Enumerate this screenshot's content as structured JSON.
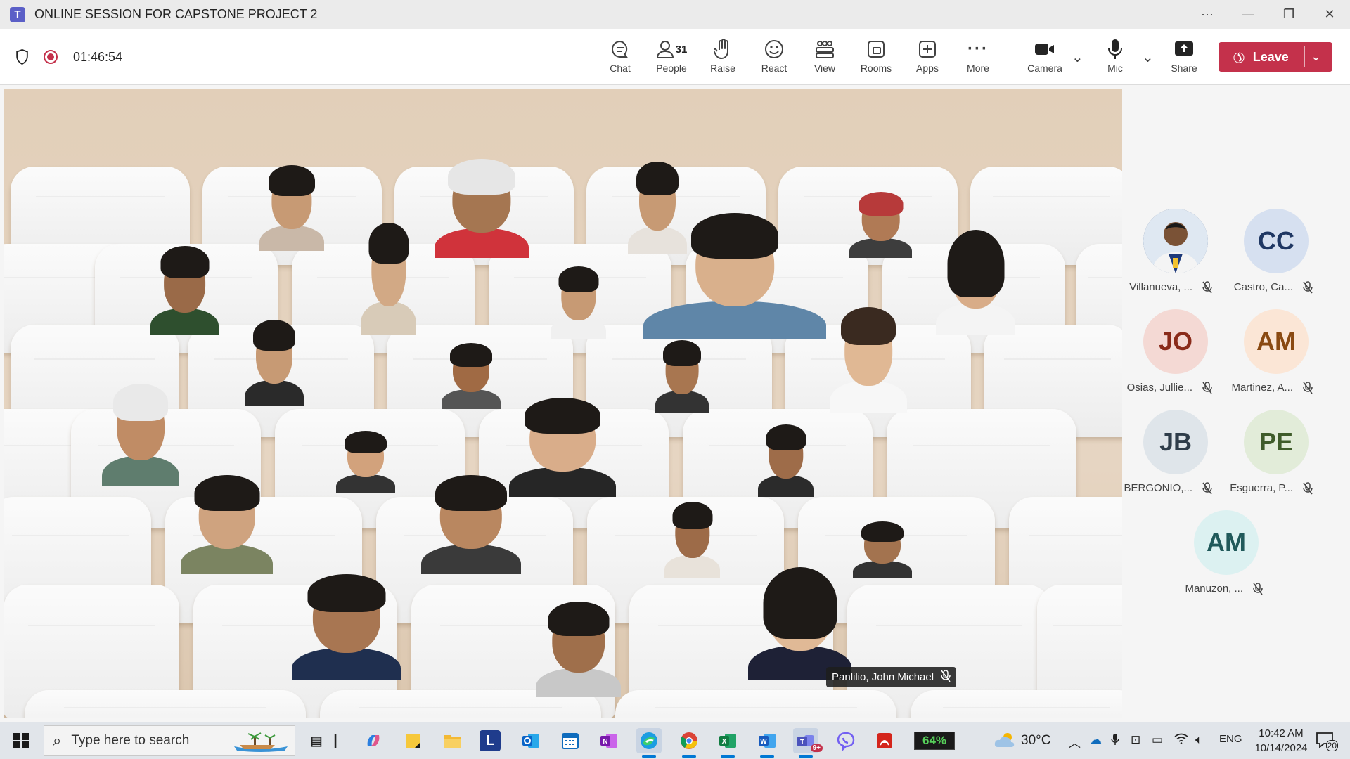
{
  "window": {
    "title": "ONLINE SESSION FOR CAPSTONE PROJECT 2",
    "controls": [
      "more-icon",
      "minimize-icon",
      "restore-icon",
      "close-icon"
    ]
  },
  "toolbar": {
    "timer": "01:46:54",
    "items": [
      {
        "label": "Chat",
        "icon": "chat-icon"
      },
      {
        "label": "People",
        "icon": "people-icon",
        "count": "31"
      },
      {
        "label": "Raise",
        "icon": "raise-hand-icon"
      },
      {
        "label": "React",
        "icon": "react-icon"
      },
      {
        "label": "View",
        "icon": "view-icon"
      },
      {
        "label": "Rooms",
        "icon": "rooms-icon"
      },
      {
        "label": "Apps",
        "icon": "apps-icon"
      },
      {
        "label": "More",
        "icon": "more-icon"
      },
      {
        "label": "Camera",
        "icon": "camera-icon"
      },
      {
        "label": "Mic",
        "icon": "mic-icon"
      },
      {
        "label": "Share",
        "icon": "share-icon"
      }
    ],
    "leave_label": "Leave",
    "leave_color": "#c4314b"
  },
  "stage": {
    "mode": "together-mode",
    "active_speaker_tag": "Panlilio, John Michael"
  },
  "participants_panel": [
    {
      "initials": "",
      "name": "Villanueva, ...",
      "avatar_type": "photo",
      "muted": true
    },
    {
      "initials": "CC",
      "name": "Castro, Ca...",
      "color": "#d6e0f0",
      "text_color": "#1f3763",
      "muted": true
    },
    {
      "initials": "JO",
      "name": "Osias, Jullie...",
      "color": "#f4d9d4",
      "text_color": "#8a2b1a",
      "muted": true
    },
    {
      "initials": "AM",
      "name": "Martinez, A...",
      "color": "#fbe6d6",
      "text_color": "#8a4a12",
      "muted": true
    },
    {
      "initials": "JB",
      "name": "BERGONIO,...",
      "color": "#dfe5ea",
      "text_color": "#2f3d4a",
      "muted": true
    },
    {
      "initials": "PE",
      "name": "Esguerra, P...",
      "color": "#e2ecd9",
      "text_color": "#3f5c2a",
      "muted": true
    },
    {
      "initials": "AM",
      "name": "Manuzon, ...",
      "color": "#dcf1f1",
      "text_color": "#20595a",
      "muted": true
    }
  ],
  "taskbar": {
    "search_placeholder": "Type here to search",
    "battery_percent": "64%",
    "weather_temp": "30°C",
    "language": "ENG",
    "time": "10:42 AM",
    "date": "10/14/2024",
    "notification_count": "20",
    "teams_badge": "9+",
    "apps": [
      "task-view-icon",
      "copilot-icon",
      "sticky-notes-icon",
      "file-explorer-icon",
      "l-app-icon",
      "outlook-icon",
      "calendar-icon",
      "onenote-icon",
      "edge-icon",
      "chrome-icon",
      "excel-icon",
      "word-icon",
      "teams-icon",
      "viber-icon",
      "acrobat-icon"
    ]
  }
}
